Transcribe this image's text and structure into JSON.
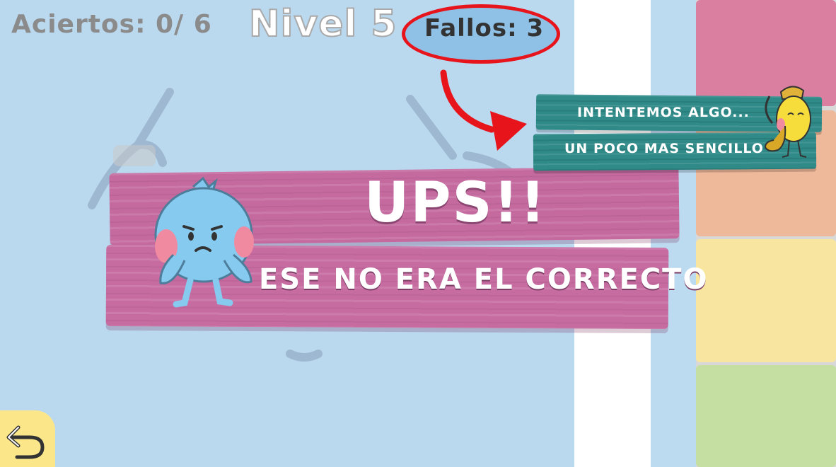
{
  "hud": {
    "score_text": "Aciertos: 0/ 6",
    "level_text": "Nivel 5",
    "fails_text": "Fallos: 3"
  },
  "popup": {
    "title": "UPS!!",
    "message": "ESE NO ERA EL CORRECTO"
  },
  "hint_banner": {
    "line1": "INTENTEMOS ALGO...",
    "line2": "UN POCO MAS SENCILLO"
  },
  "palette": {
    "colors": [
      "#db7fa0",
      "#eeb89a",
      "#f8e6a0",
      "#c5dfa3"
    ]
  },
  "icons": {
    "back": "undo-arrow-icon",
    "sad_character": "blue-sad-character-icon",
    "mascot": "yellow-mascot-saxophone-icon",
    "annotation_arrow": "red-curved-arrow-icon"
  },
  "colors": {
    "background": "#bad9ef",
    "popup_board": "#c46a9f",
    "hint_board": "#2f8a88",
    "highlight": "#e8141c",
    "back_button": "#fbe78a"
  }
}
